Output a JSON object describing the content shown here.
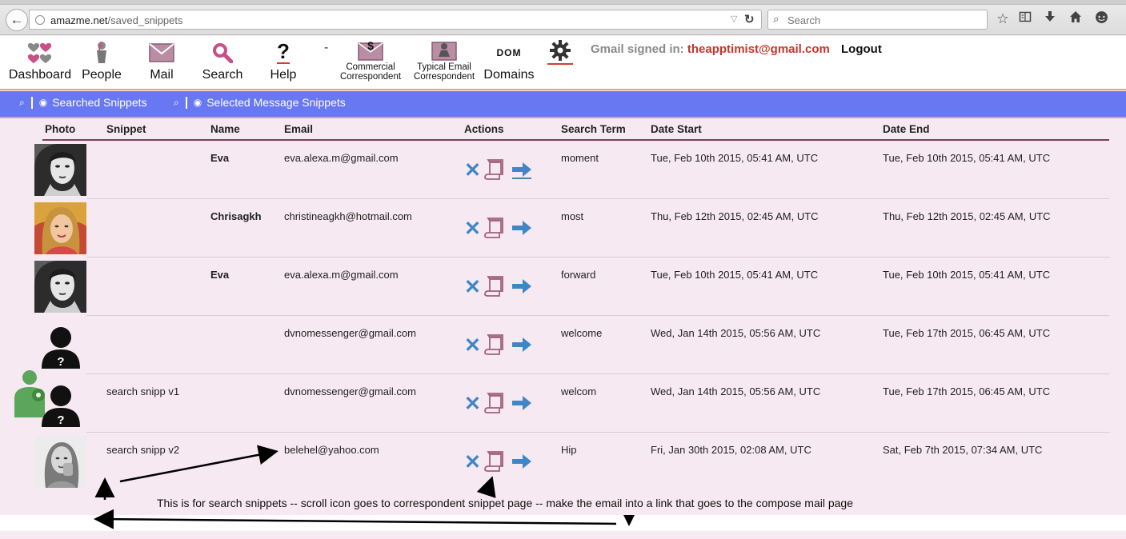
{
  "browser": {
    "url_domain": "amazme.net",
    "url_path": "/saved_snippets",
    "search_placeholder": "Search"
  },
  "nav": {
    "items": [
      {
        "label": "Dashboard"
      },
      {
        "label": "People"
      },
      {
        "label": "Mail"
      },
      {
        "label": "Search"
      },
      {
        "label": "Help"
      }
    ],
    "separator": "-",
    "commercial_line1": "Commercial",
    "commercial_line2": "Correspondent",
    "typical_line1": "Typical Email",
    "typical_line2": "Correspondent",
    "dom_badge": "DOM",
    "domains_label": "Domains",
    "signed_in_label": "Gmail signed in:",
    "signed_in_email": "theapptimist@gmail.com",
    "logout_label": "Logout"
  },
  "tabs": [
    {
      "label": "Searched Snippets"
    },
    {
      "label": "Selected Message Snippets"
    }
  ],
  "table": {
    "headers": [
      "Photo",
      "Snippet",
      "Name",
      "Email",
      "Actions",
      "Search Term",
      "Date Start",
      "Date End"
    ],
    "rows": [
      {
        "snippet": "",
        "name": "Eva",
        "email": "eva.alexa.m@gmail.com",
        "search_term": "moment",
        "date_start": "Tue, Feb 10th 2015, 05:41 AM, UTC",
        "date_end": "Tue, Feb 10th 2015, 05:41 AM, UTC"
      },
      {
        "snippet": "",
        "name": "Chrisagkh",
        "email": "christineagkh@hotmail.com",
        "search_term": "most",
        "date_start": "Thu, Feb 12th 2015, 02:45 AM, UTC",
        "date_end": "Thu, Feb 12th 2015, 02:45 AM, UTC"
      },
      {
        "snippet": "",
        "name": "Eva",
        "email": "eva.alexa.m@gmail.com",
        "search_term": "forward",
        "date_start": "Tue, Feb 10th 2015, 05:41 AM, UTC",
        "date_end": "Tue, Feb 10th 2015, 05:41 AM, UTC"
      },
      {
        "snippet": "",
        "name": "",
        "email": "dvnomessenger@gmail.com",
        "search_term": "welcome",
        "date_start": "Wed, Jan 14th 2015, 05:56 AM, UTC",
        "date_end": "Tue, Feb 17th 2015, 06:45 AM, UTC"
      },
      {
        "snippet": "search snipp v1",
        "name": "",
        "email": "dvnomessenger@gmail.com",
        "search_term": "welcom",
        "date_start": "Wed, Jan 14th 2015, 05:56 AM, UTC",
        "date_end": "Tue, Feb 17th 2015, 06:45 AM, UTC"
      },
      {
        "snippet": "search snipp v2",
        "name": "",
        "email": "belehel@yahoo.com",
        "search_term": "Hip",
        "date_start": "Fri, Jan 30th 2015, 02:08 AM, UTC",
        "date_end": "Sat, Feb 7th 2015, 07:34 AM, UTC"
      }
    ]
  },
  "annotation": "This is for search snippets -- scroll icon goes to correspondent snippet page -- make the email into a link that goes to the compose mail page",
  "colors": {
    "band": "#6878f2",
    "action_blue": "#3f86c8",
    "scroll_pink": "#a0627a",
    "signed_email": "#c9342a",
    "page_bg": "#f7e9f1"
  }
}
